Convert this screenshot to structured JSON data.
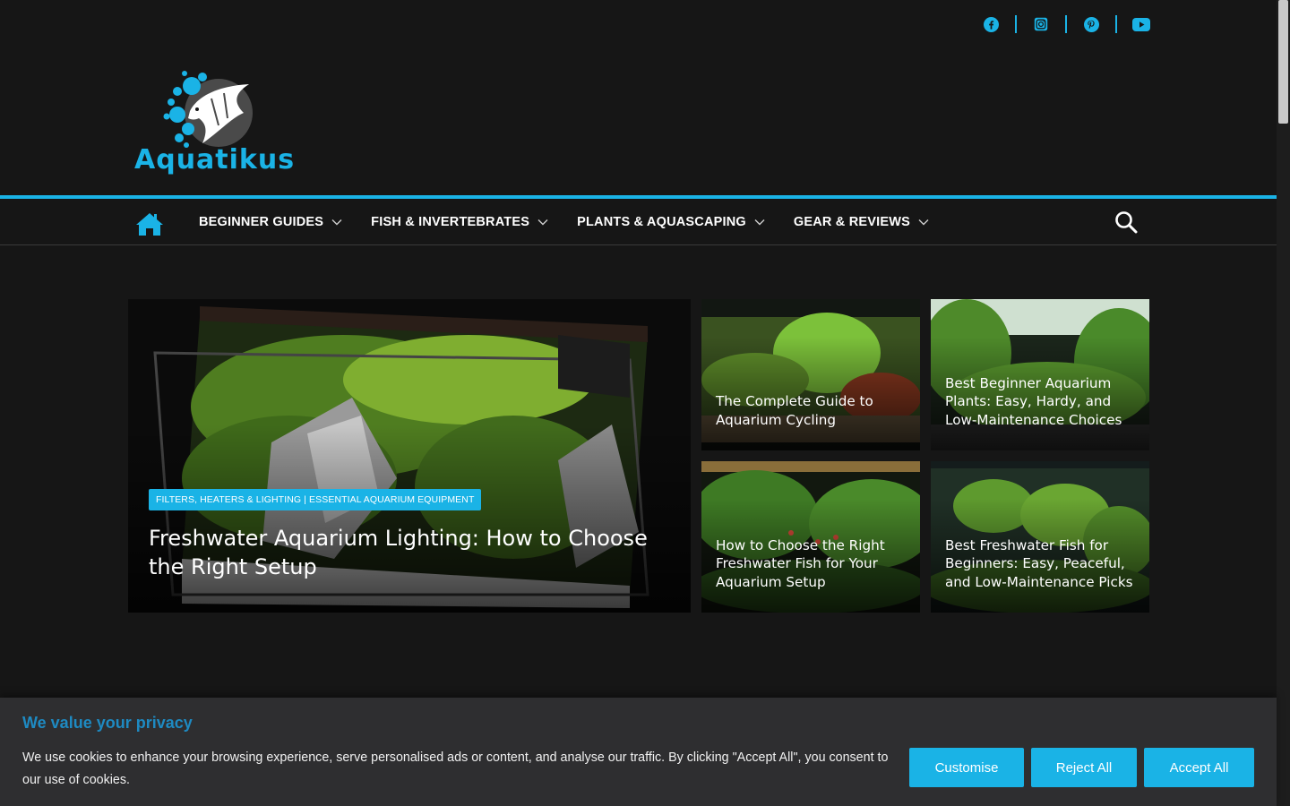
{
  "site": {
    "name": "Aquatikus",
    "brand_color": "#1ab3e6"
  },
  "social": [
    "facebook-icon",
    "instagram-icon",
    "pinterest-icon",
    "youtube-icon"
  ],
  "nav": {
    "items": [
      {
        "label": "BEGINNER GUIDES"
      },
      {
        "label": "FISH & INVERTEBRATES"
      },
      {
        "label": "PLANTS & AQUASCAPING"
      },
      {
        "label": "GEAR & REVIEWS"
      }
    ]
  },
  "featured": {
    "category": "FILTERS, HEATERS & LIGHTING | ESSENTIAL AQUARIUM EQUIPMENT",
    "title": "Freshwater Aquarium Lighting: How to Choose the Right Setup"
  },
  "posts": [
    {
      "title": "The Complete Guide to Aquarium Cycling"
    },
    {
      "title": "Best Beginner Aquarium Plants: Easy, Hardy, and Low-Maintenance Choices"
    },
    {
      "title": "How to Choose the Right Freshwater Fish for Your Aquarium Setup"
    },
    {
      "title": "Best Freshwater Fish for Beginners: Easy, Peaceful, and Low-Maintenance Picks"
    }
  ],
  "cookie": {
    "title": "We value your privacy",
    "text": "We use cookies to enhance your browsing experience, serve personalised ads or content, and analyse our traffic. By clicking \"Accept All\", you consent to our use of cookies.",
    "customise": "Customise",
    "reject": "Reject All",
    "accept": "Accept All"
  }
}
